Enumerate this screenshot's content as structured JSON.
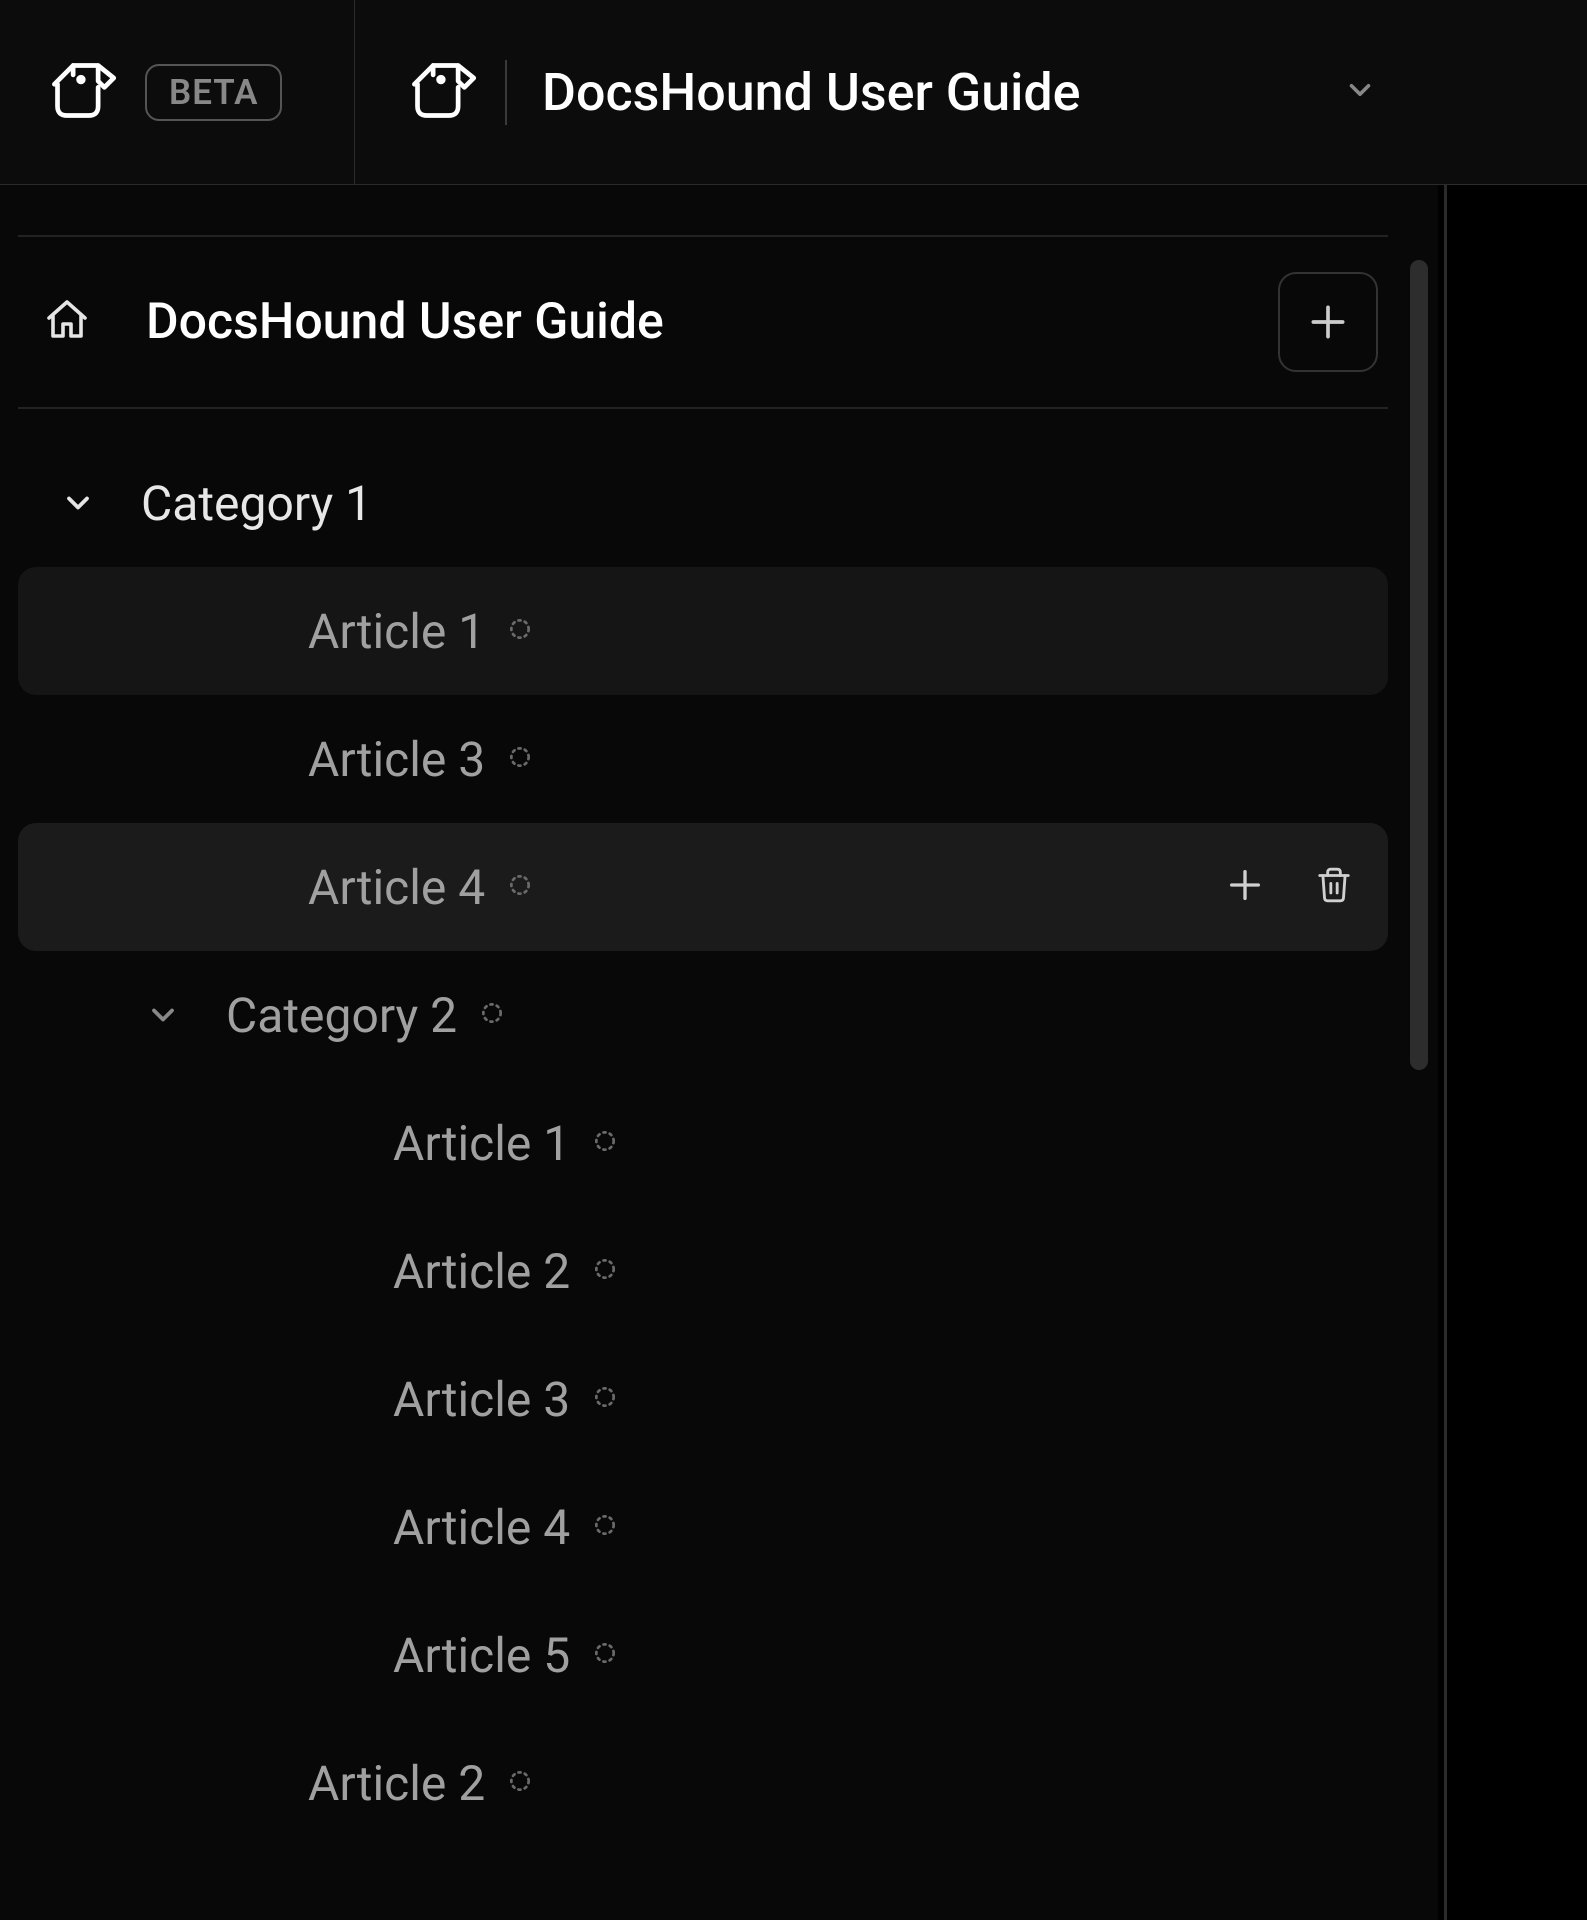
{
  "topbar": {
    "beta_label": "BETA",
    "project_title": "DocsHound User Guide"
  },
  "sidebar": {
    "page_title": "DocsHound User Guide",
    "tree": [
      {
        "type": "category",
        "label": "Category 1",
        "depth": 0,
        "expanded": true,
        "draft": false,
        "selected": false,
        "hovered": false
      },
      {
        "type": "article",
        "label": "Article 1",
        "depth": 1,
        "draft": true,
        "selected": true,
        "hovered": false
      },
      {
        "type": "article",
        "label": "Article 3",
        "depth": 1,
        "draft": true,
        "selected": false,
        "hovered": false
      },
      {
        "type": "article",
        "label": "Article 4",
        "depth": 1,
        "draft": true,
        "selected": false,
        "hovered": true
      },
      {
        "type": "category",
        "label": "Category 2",
        "depth": 1,
        "expanded": true,
        "draft": true,
        "selected": false,
        "hovered": false
      },
      {
        "type": "article",
        "label": "Article 1",
        "depth": 2,
        "draft": true,
        "selected": false,
        "hovered": false
      },
      {
        "type": "article",
        "label": "Article 2",
        "depth": 2,
        "draft": true,
        "selected": false,
        "hovered": false
      },
      {
        "type": "article",
        "label": "Article 3",
        "depth": 2,
        "draft": true,
        "selected": false,
        "hovered": false
      },
      {
        "type": "article",
        "label": "Article 4",
        "depth": 2,
        "draft": true,
        "selected": false,
        "hovered": false
      },
      {
        "type": "article",
        "label": "Article 5",
        "depth": 2,
        "draft": true,
        "selected": false,
        "hovered": false
      },
      {
        "type": "article",
        "label": "Article 2",
        "depth": 1,
        "draft": true,
        "selected": false,
        "hovered": false
      }
    ]
  }
}
